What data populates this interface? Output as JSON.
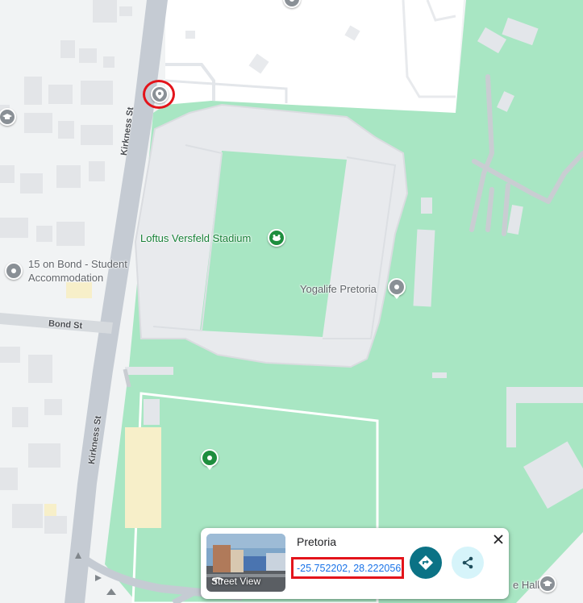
{
  "map": {
    "roads": {
      "kirkness_upper": "Kirkness St",
      "kirkness_lower": "Kirkness St",
      "bond": "Bond St"
    },
    "places": {
      "stadium": "Loftus Versfeld Stadium",
      "yogalife": "Yogalife Pretoria",
      "accommodation_line1": "15 on Bond - Student",
      "accommodation_line2": "Accommodation",
      "hall_partial": "e Hall"
    },
    "colors": {
      "park": "#a8e6c3",
      "building": "#e8eaed",
      "road": "#c5cbd3",
      "label_green": "#188038",
      "label_gray": "#5f6368",
      "marker_highlight": "#e3141b"
    }
  },
  "card": {
    "title": "Pretoria",
    "coordinates": "-25.752202, 28.222056",
    "street_view_label": "Street View",
    "icons": {
      "directions": "directions-icon",
      "share": "share-icon",
      "close": "close-icon",
      "street_view": "street-view-icon"
    },
    "colors": {
      "directions_bg": "#0b7285",
      "share_bg": "#d6f4fa",
      "highlight": "#e3141b"
    }
  }
}
